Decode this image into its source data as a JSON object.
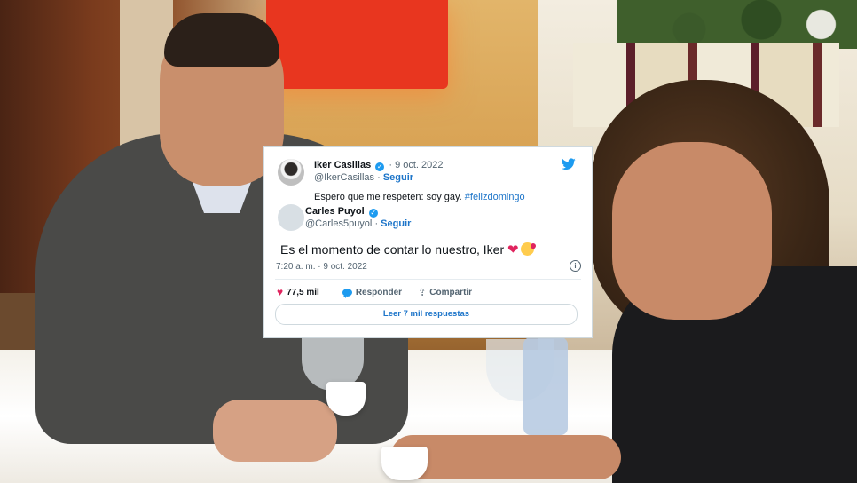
{
  "quoted_tweet": {
    "name": "Iker Casillas",
    "handle": "@IkerCasillas",
    "date": "9 oct. 2022",
    "follow_label": "Seguir",
    "text": "Espero que me respeten: soy gay.",
    "hashtag": "#felizdomingo",
    "avatar_icon": "profile-photo"
  },
  "main_tweet": {
    "name": "Carles Puyol",
    "handle": "@Carles5puyol",
    "follow_label": "Seguir",
    "text": "Es el momento de contar lo nuestro, Iker",
    "emoji_heart": "❤",
    "timestamp": "7:20 a. m. · 9 oct. 2022",
    "avatar_icon": "default-avatar"
  },
  "actions": {
    "likes": "77,5 mil",
    "reply_label": "Responder",
    "share_label": "Compartir",
    "read_replies_label": "Leer 7 mil respuestas"
  },
  "colors": {
    "twitter_blue": "#1d9bf0",
    "link_blue": "#1d75c9",
    "heart_red": "#e0245e"
  }
}
